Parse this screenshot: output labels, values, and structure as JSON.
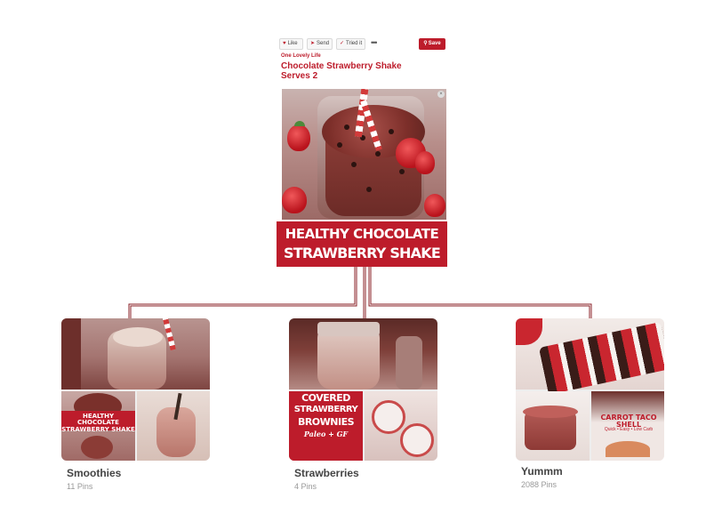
{
  "pin": {
    "actions": {
      "like": "Like",
      "send": "Send",
      "tried": "Tried it",
      "more": "•••",
      "save": "Save"
    },
    "source": "One Lovely Life",
    "title_line1": "Chocolate Strawberry Shake",
    "title_line2": "Serves 2",
    "banner_line1": "HEALTHY CHOCOLATE",
    "banner_line2": "STRAWBERRY SHAKE"
  },
  "boards": [
    {
      "name": "Smoothies",
      "count": "11 Pins",
      "overlay_line1": "HEALTHY CHOCOLATE",
      "overlay_line2": "STRAWBERRY SHAKE"
    },
    {
      "name": "Strawberries",
      "count": "4 Pins",
      "overlay_line1": "COVERED",
      "overlay_line2": "STRAWBERRY",
      "overlay_line3": "BROWNIES",
      "overlay_line4": "Paleo + GF"
    },
    {
      "name": "Yummm",
      "count": "2088 Pins",
      "overlay_line1": "CARROT TACO SHELL",
      "overlay_line2": "Quick • Easy • Low Carb"
    }
  ],
  "colors": {
    "accent": "#bd1c2b",
    "connector": "#8a1f26",
    "muted": "#999999"
  },
  "icons": {
    "like": "heart-icon",
    "send": "send-icon",
    "tried": "check-icon",
    "save": "pin-icon",
    "close": "close-icon"
  }
}
